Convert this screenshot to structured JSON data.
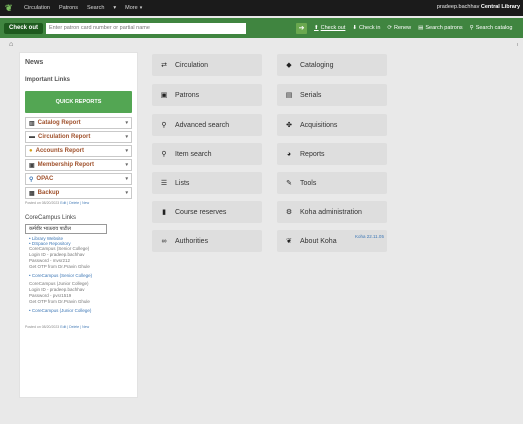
{
  "topnav": {
    "items": [
      "Circulation",
      "Patrons",
      "Search"
    ],
    "more_label": "More",
    "user_name": "pradeep.bachhav",
    "library": "Central Library"
  },
  "searchbar": {
    "checkout_label": "Check out",
    "placeholder": "Enter patron card number or partial name",
    "quick_links": [
      "Check out",
      "Check in",
      "Renew",
      "Search patrons",
      "Search catalog"
    ]
  },
  "left": {
    "news": "News",
    "important": "Important Links",
    "quick_reports": "QUICK REPORTS",
    "reports": [
      {
        "label": "Catalog Report",
        "icon": "book-icon"
      },
      {
        "label": "Circulation Report",
        "icon": "monitor-icon"
      },
      {
        "label": "Accounts Report",
        "icon": "coins-icon"
      },
      {
        "label": "Membership Report",
        "icon": "id-card-icon"
      },
      {
        "label": "OPAC",
        "icon": "search-icon"
      },
      {
        "label": "Backup",
        "icon": "calendar-icon"
      }
    ],
    "posted1": "Posted on 08/20/2023",
    "posted1_links": "Edit | Delete | New",
    "corecampus_title": "CoreCampus Links",
    "hindi_text": "कर्मवीर भाऊराव पाटील",
    "links_a": [
      "Library Website",
      "DSpace Repository"
    ],
    "info_senior": [
      "CoreCampus (Senior College)",
      "Login ID - pradeep.bachhav",
      "Password - mvsr212",
      "Get OTP from Dr.Pravin Ghule"
    ],
    "link_senior": "CoreCampus (Senior College)",
    "info_junior": [
      "CoreCampus (Junior College)",
      "Login ID - pradeep.bachhav",
      "Password - pvsr1519",
      "Get OTP from Dr.Pravin Ghule"
    ],
    "link_junior": "CoreCampus (Junior College)",
    "posted2": "Posted on 08/20/2023",
    "posted2_links": "Edit | Delete | New"
  },
  "modules": {
    "left_col": [
      "Circulation",
      "Patrons",
      "Advanced search",
      "Item search",
      "Lists",
      "Course reserves",
      "Authorities"
    ],
    "right_col": [
      "Cataloging",
      "Serials",
      "Acquisitions",
      "Reports",
      "Tools",
      "Koha administration",
      "About Koha"
    ],
    "version": "Koha 22.11.05"
  },
  "colors": {
    "navbar": "#1b1b1b",
    "searchbar": "#408540",
    "quick_reports": "#53a653",
    "report_text": "#a0522d"
  }
}
